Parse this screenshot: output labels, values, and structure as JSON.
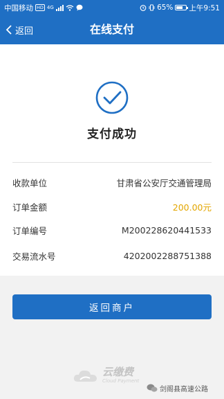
{
  "status_bar": {
    "carrier": "中国移动",
    "hd_badge": "HD",
    "network": "4G",
    "battery": "65%",
    "battery_fraction": 0.65,
    "time": "上午9:51"
  },
  "nav": {
    "back_label": "返回",
    "title": "在线支付"
  },
  "result": {
    "title": "支付成功"
  },
  "details": [
    {
      "label": "收款单位",
      "value": "甘肃省公安厅交通管理局",
      "highlight": false
    },
    {
      "label": "订单金额",
      "value": "200.00元",
      "highlight": true
    },
    {
      "label": "订单编号",
      "value": "M200228620441533",
      "highlight": false
    },
    {
      "label": "交易流水号",
      "value": "4202002288751388",
      "highlight": false
    }
  ],
  "actions": {
    "return_label": "返回商户"
  },
  "brand": {
    "name": "云缴费",
    "sub": "Cloud Payment"
  },
  "watermark": {
    "text": "剑阁县高速公路"
  },
  "colors": {
    "primary": "#1f6fc4",
    "amount": "#e3a600",
    "background": "#f2f2f2"
  }
}
